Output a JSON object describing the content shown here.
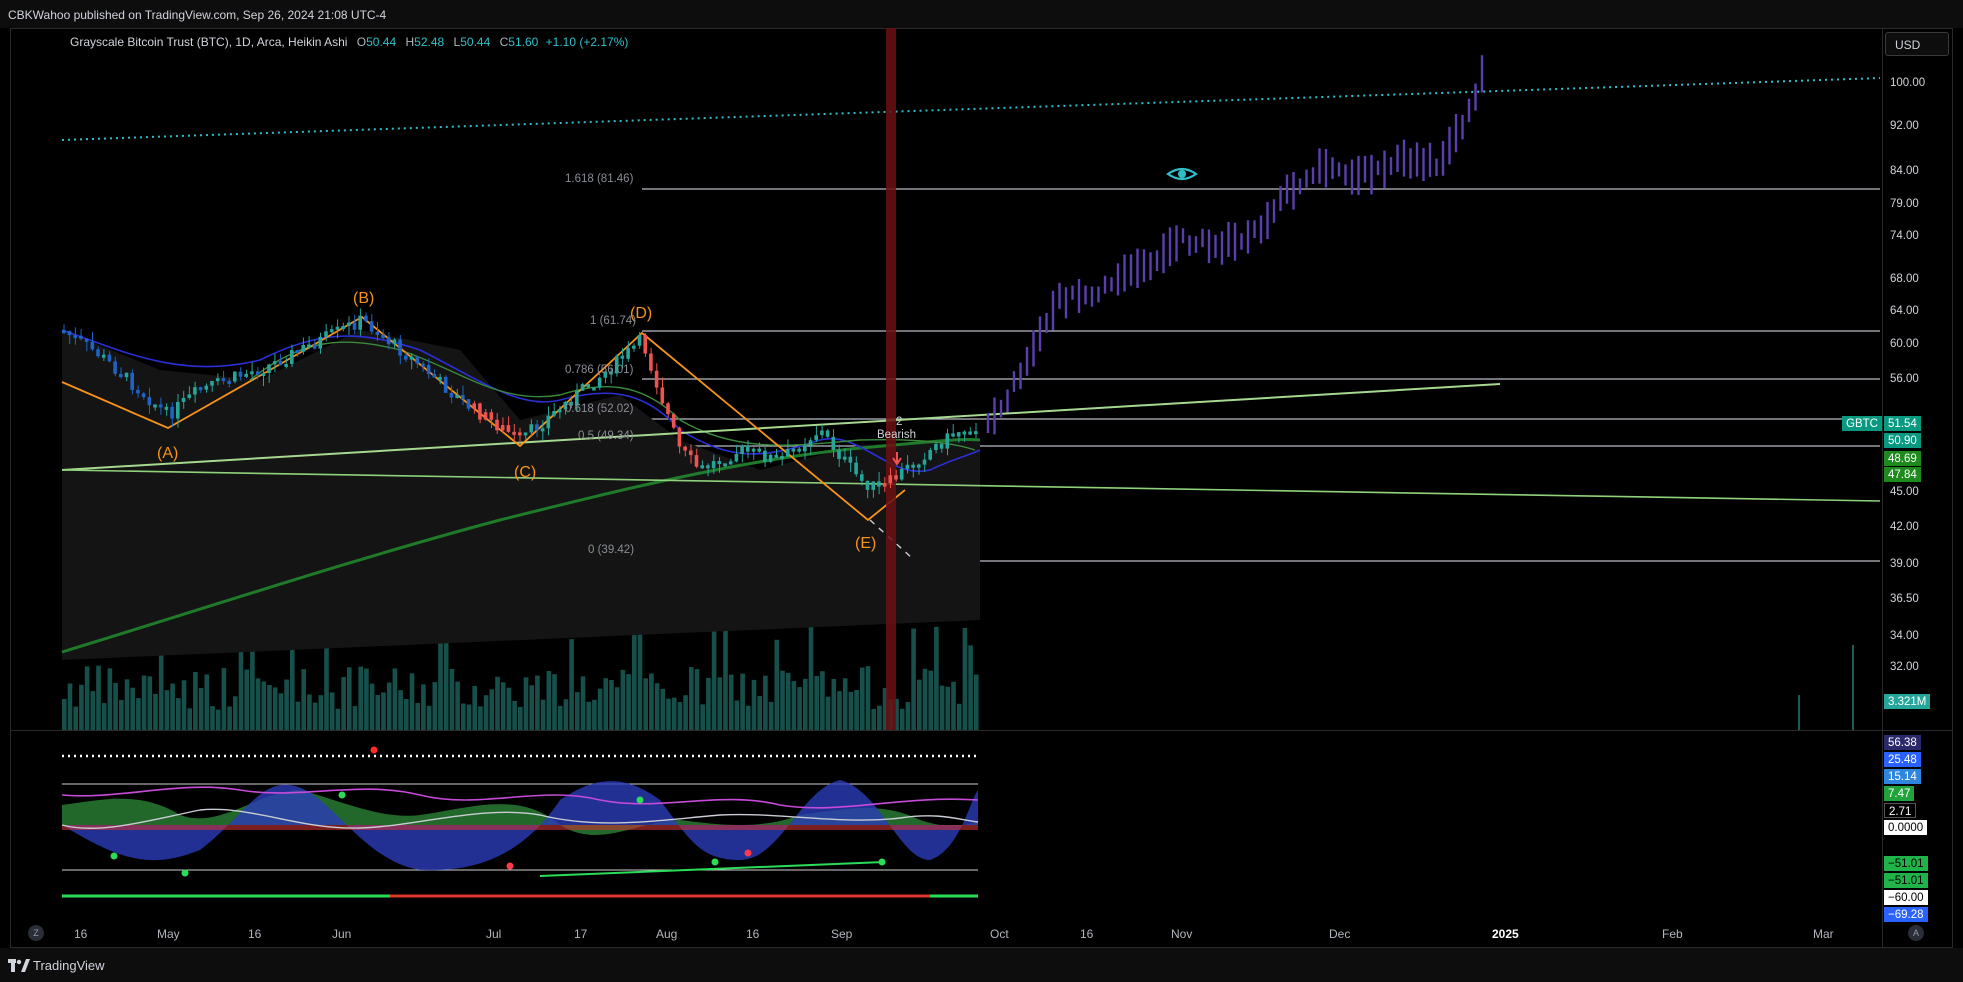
{
  "header": {
    "published": "CBKWahoo published on TradingView.com, Sep 26, 2024 21:08 UTC-4"
  },
  "legend": {
    "symbol": "Grayscale Bitcoin Trust (BTC), 1D, Arca, Heikin Ashi",
    "o_label": "O",
    "o": "50.44",
    "h_label": "H",
    "h": "52.48",
    "l_label": "L",
    "l": "50.44",
    "c_label": "C",
    "c": "51.60",
    "change": "+1.10 (+2.17%)"
  },
  "currency_button": "USD",
  "price_axis": [
    "100.00",
    "92.00",
    "84.00",
    "79.00",
    "74.00",
    "68.00",
    "64.00",
    "60.00",
    "56.00",
    "45.00",
    "42.00",
    "39.00",
    "36.50",
    "34.00",
    "32.00"
  ],
  "price_badges": {
    "symbol": "GBTC",
    "last": "51.54",
    "b1": "50.90",
    "b2": "48.69",
    "b3": "47.84",
    "volume": "3.321M"
  },
  "indicator_badges": [
    "56.38",
    "25.48",
    "15.14",
    "7.47",
    "2.71",
    "0.0000",
    "−51.01",
    "−51.01",
    "−60.00",
    "−69.28"
  ],
  "time_axis": [
    {
      "label": "16",
      "bold": false
    },
    {
      "label": "May",
      "bold": false
    },
    {
      "label": "16",
      "bold": false
    },
    {
      "label": "Jun",
      "bold": false
    },
    {
      "label": "Jul",
      "bold": false
    },
    {
      "label": "17",
      "bold": false
    },
    {
      "label": "Aug",
      "bold": false
    },
    {
      "label": "16",
      "bold": false
    },
    {
      "label": "Sep",
      "bold": false
    },
    {
      "label": "Oct",
      "bold": false
    },
    {
      "label": "16",
      "bold": false
    },
    {
      "label": "Nov",
      "bold": false
    },
    {
      "label": "Dec",
      "bold": false
    },
    {
      "label": "2025",
      "bold": true
    },
    {
      "label": "Feb",
      "bold": false
    },
    {
      "label": "Mar",
      "bold": false
    }
  ],
  "wave_labels": [
    "(A)",
    "(B)",
    "(C)",
    "(D)",
    "(E)"
  ],
  "fib_labels": [
    "1.618 (81.46)",
    "1 (61.74)",
    "0.786 (56.01)",
    "0.618 (52.02)",
    "0.5 (49.34)",
    "0 (39.42)"
  ],
  "annotations": {
    "bearish": "Bearish",
    "count": "2"
  },
  "axis_buttons": {
    "left": "Z",
    "right": "A"
  },
  "footer": {
    "brand": "TradingView"
  },
  "colors": {
    "wave": "#f7931a",
    "fib": "#d1d4dc",
    "trend": "#8fd27b",
    "projection": "#5b3fb0",
    "up": "#26a69a",
    "down": "#ef5350",
    "accent": "#2ec0c9"
  }
}
